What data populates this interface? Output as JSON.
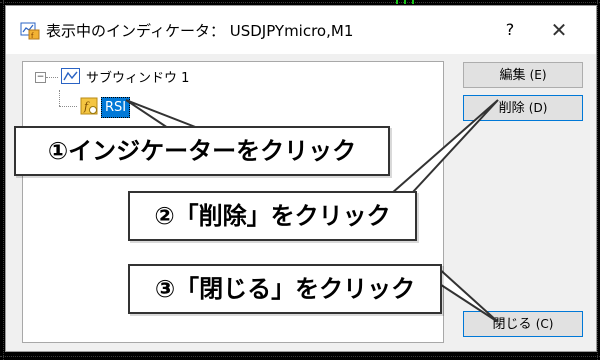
{
  "window": {
    "title": "表示中のインディケータ： USDJPYmicro,M1",
    "help_label": "?",
    "close_label": "✕"
  },
  "tree": {
    "root_label": "サブウィンドウ 1",
    "child_label": "RSI",
    "toggle_glyph": "−"
  },
  "buttons": {
    "edit": {
      "label": "編集",
      "key": "(E)"
    },
    "delete": {
      "label": "削除",
      "key": "(D)"
    },
    "close": {
      "label": "閉じる",
      "key": "(C)"
    }
  },
  "callouts": {
    "step1": "①インジケーターをクリック",
    "step2": "②「削除」をクリック",
    "step3": "③「閉じる」をクリック"
  },
  "colors": {
    "selection": "#0078d7",
    "chart_bg": "#000000",
    "chart_green": "#17c617"
  },
  "icons": {
    "app": "dialog-app-icon",
    "subwindow": "subwindow-chart-icon",
    "indicator": "custom-indicator-icon"
  }
}
